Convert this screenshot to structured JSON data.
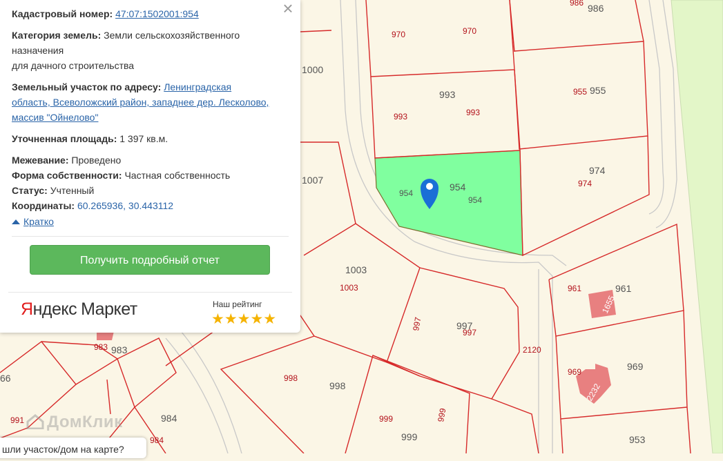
{
  "map": {
    "plots": [
      {
        "num_red": "986",
        "num_grey": "986"
      },
      {
        "num_red": "970",
        "num_grey": "970"
      },
      {
        "num_red": "993",
        "num_grey": "993",
        "num_red2": "993"
      },
      {
        "num_red": "955",
        "num_grey": "955"
      },
      {
        "num_red": "954",
        "num_grey": "954",
        "num_red2": "954"
      },
      {
        "num_red": "974",
        "num_grey": "974"
      },
      {
        "num_red": "1003",
        "num_grey": "1003"
      },
      {
        "num_red": "997",
        "num_grey": "997",
        "num_red2": "997"
      },
      {
        "num_red": "961",
        "num_grey": "961",
        "building": "1655"
      },
      {
        "num_red": "2120"
      },
      {
        "num_red": "969",
        "num_grey": "969",
        "building": "2232"
      },
      {
        "num_red": "998",
        "num_grey": "998"
      },
      {
        "num_red": "999",
        "num_grey": "999",
        "num_red2": "999"
      },
      {
        "num_grey": "953"
      },
      {
        "num_red": "983",
        "num_grey": "983"
      },
      {
        "num_red": "984",
        "num_grey": "984"
      },
      {
        "num_red": "991"
      },
      {
        "num_grey": "1000"
      },
      {
        "num_grey": "1007"
      },
      {
        "num_grey": "66"
      }
    ],
    "watermark": "ДомКлик",
    "selected_color": "#80ff9f",
    "plot_border_color": "#d62929"
  },
  "card": {
    "close_symbol": "×",
    "cadastral_label": "Кадастровый номер:",
    "cadastral_value": "47:07:1502001:954",
    "category_label": "Категория земель:",
    "category_value": "Земли сельскохозяйственного",
    "category_line2": "назначения",
    "category_line3": "для дачного строительства",
    "address_label": "Земельный участок по адресу:",
    "address_line1": "Ленинградская",
    "address_line2": "область, Всеволожский район, западнее дер. Лесколово,",
    "address_line3": "массив \"Ойнелово\"",
    "area_label": "Уточненная площадь:",
    "area_value": "1 397 кв.м.",
    "survey_label": "Межевание:",
    "survey_value": "Проведено",
    "ownership_label": "Форма собственности:",
    "ownership_value": "Частная собственность",
    "status_label": "Статус:",
    "status_value": "Учтенный",
    "coords_label": "Координаты:",
    "coords_value": "60.265936, 30.443112",
    "toggle_label": "Кратко",
    "report_button": "Получить подробный отчет",
    "brand_part1": "Я",
    "brand_part2": "ндекс",
    "brand_part3": "Маркет",
    "rating_label": "Наш рейтинг",
    "stars": "★★★★★",
    "stars_count": 5,
    "accent_green": "#5cb85c",
    "link_color": "#2a64a8",
    "star_color": "#f5b301"
  },
  "bottom_prompt": "шли участок/дом на карте?"
}
